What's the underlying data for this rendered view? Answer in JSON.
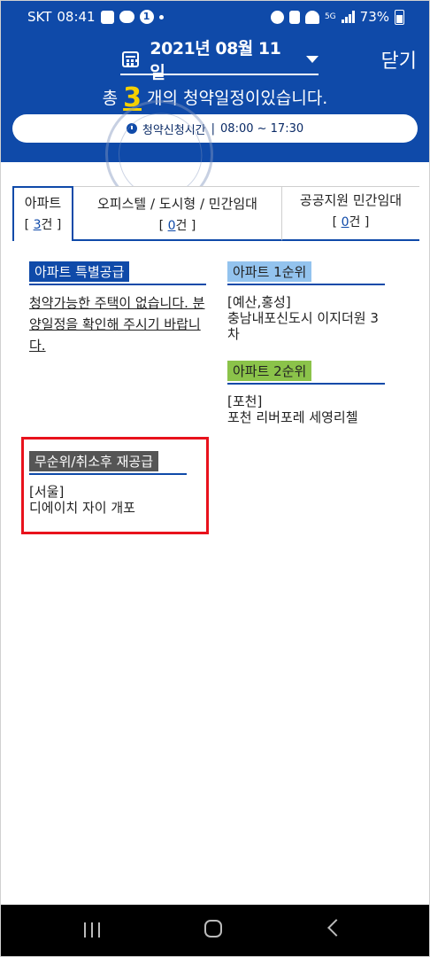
{
  "status_bar": {
    "carrier": "SKT",
    "time": "08:41",
    "notification_count": "1",
    "network": "5G",
    "battery": "73%"
  },
  "header": {
    "date": "2021년 08월 11일",
    "close_label": "닫기",
    "summary_prefix": "총",
    "summary_count": "3",
    "summary_suffix": "개의 청약일정이있습니다.",
    "time_label": "청약신청시간",
    "time_separator": "|",
    "time_range": "08:00 ~ 17:30"
  },
  "tabs": [
    {
      "label": "아파트",
      "count": "3",
      "count_suffix": "건"
    },
    {
      "label": "오피스텔 / 도시형 / 민간임대",
      "count": "0",
      "count_suffix": "건"
    },
    {
      "label": "공공지원 민간임대",
      "count": "0",
      "count_suffix": "건"
    }
  ],
  "bracket_open": "[",
  "bracket_close": "]",
  "sections": {
    "special": {
      "title": "아파트 특별공급",
      "message": "청약가능한 주택이 없습니다. 분양일정을 확인해 주시기 바랍니다."
    },
    "first": {
      "title": "아파트 1순위",
      "region": "[예산,홍성]",
      "name": "충남내포신도시 이지더원 3차"
    },
    "second": {
      "title": "아파트 2순위",
      "region": "[포천]",
      "name": "포천 리버포레 세영리첼"
    },
    "resupply": {
      "title": "무순위/취소후 재공급",
      "region": "[서울]",
      "name": "디에이치 자이 개포"
    }
  },
  "colors": {
    "brand_blue": "#0f4aa9",
    "count_yellow": "#f5d000",
    "first_rank": "#93c3ee",
    "second_rank": "#8bc34a",
    "resupply": "#555555",
    "highlight_red": "#e8121c"
  },
  "icons": [
    "calendar-icon",
    "dropdown-caret-icon",
    "clock-icon",
    "recent-apps-icon",
    "home-icon",
    "back-icon"
  ]
}
